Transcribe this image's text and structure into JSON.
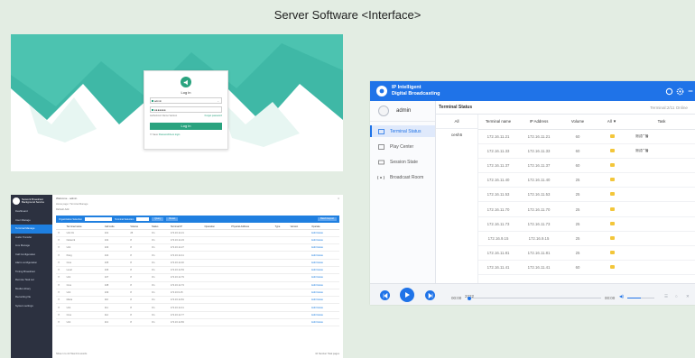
{
  "page": {
    "title": "Server Software <Interface>"
  },
  "login": {
    "title": "Log in",
    "username": "admin",
    "password_mask": "●●●●●●●",
    "meta_left": "Authorized: Demo Version",
    "meta_right": "Forget password",
    "button": "Log in",
    "remember_prefix": "Save",
    "remember_link": "Password/Auto login",
    "colors": {
      "accent": "#2aa37f",
      "background": "#3fb8a6"
    }
  },
  "admin": {
    "brand": "Network Broadcast Background Service",
    "top_left": "Welcome - admin",
    "breadcrumb": "Home page / Terminal Manage",
    "tools": "Refresh  Add",
    "filter": {
      "left_label": "Organization Selection",
      "mid_label": "Terminal Selection",
      "search": "Query",
      "reset": "Reset",
      "export": "Batch Export"
    },
    "menu": [
      "Dashboard",
      "User Manage",
      "Terminal Manage",
      "Audio Transfer",
      "Live Manage",
      "Call Configuration",
      "Alarm configuration",
      "Timing Broadcast",
      "Remote Task set",
      "Media Library",
      "Recording file",
      "System settings"
    ],
    "columns": [
      "",
      "Terminal name",
      "Call code",
      "Volume",
      "Status",
      "Terminal IP",
      "Operation",
      "Physical Address",
      "Type",
      "Version",
      "Operate"
    ],
    "rows": [
      [
        "",
        "Unit 01",
        "101",
        "25",
        "On",
        "172.16.11.21",
        "",
        "",
        "",
        "",
        "Edit Delete"
      ],
      [
        "",
        "Network",
        "102",
        "8",
        "On",
        "172.16.11.23",
        "",
        "",
        "",
        "",
        "Edit Delete"
      ],
      [
        "",
        "Unit",
        "103",
        "8",
        "On",
        "172.16.11.27",
        "",
        "",
        "",
        "",
        "Edit Delete"
      ],
      [
        "",
        "Pang",
        "104",
        "8",
        "On",
        "172.16.11.41",
        "",
        "",
        "",
        "",
        "Edit Delete"
      ],
      [
        "",
        "Cres",
        "105",
        "8",
        "On",
        "172.16.11.40",
        "",
        "",
        "",
        "",
        "Edit Delete"
      ],
      [
        "",
        "Level",
        "106",
        "8",
        "On",
        "172.16.11.53",
        "",
        "",
        "",
        "",
        "Edit Delete"
      ],
      [
        "",
        "Unit",
        "107",
        "8",
        "On",
        "172.16.11.79",
        "",
        "",
        "",
        "",
        "Edit Delete"
      ],
      [
        "",
        "Cres",
        "108",
        "8",
        "On",
        "172.16.11.73",
        "",
        "",
        "",
        "",
        "Edit Delete"
      ],
      [
        "",
        "Unit",
        "109",
        "8",
        "On",
        "172.16.9.15",
        "",
        "",
        "",
        "",
        "Edit Delete"
      ],
      [
        "",
        "Maria",
        "110",
        "8",
        "On",
        "172.16.11.81",
        "",
        "",
        "",
        "",
        "Edit Delete"
      ],
      [
        "",
        "Unit",
        "111",
        "8",
        "On",
        "172.16.11.41",
        "",
        "",
        "",
        "",
        "Edit Delete"
      ],
      [
        "",
        "Cres",
        "112",
        "8",
        "On",
        "172.16.11.77",
        "",
        "",
        "",
        "",
        "Edit Delete"
      ],
      [
        "",
        "Unit",
        "113",
        "8",
        "On",
        "172.16.11.83",
        "",
        "",
        "",
        "",
        "Edit Delete"
      ]
    ],
    "footer_left": "Show 1 to 13 Total 13 records",
    "footer_right": "10  Number  Total pages"
  },
  "terminal": {
    "brand_line1": "IP Intelligent",
    "brand_line2": "Digital Broadcasting",
    "user": "admin",
    "nav": [
      "Terminal Status",
      "Play Center",
      "Session State",
      "Broadcast Room"
    ],
    "topbar_title": "Terminal Status",
    "online_text": "Terminal:2/11 Online",
    "groups_header": "All",
    "groups": [
      "cesh5"
    ],
    "columns": [
      "Terminal name",
      "IP Address",
      "Volume",
      "All",
      "Task"
    ],
    "rows": [
      {
        "name": "172.16.11.21",
        "ip": "172.16.11.21",
        "volume": "60",
        "task": "测试广播"
      },
      {
        "name": "172.16.11.33",
        "ip": "172.16.11.33",
        "volume": "60",
        "task": "测试广播"
      },
      {
        "name": "172.16.11.37",
        "ip": "172.16.11.37",
        "volume": "60",
        "task": ""
      },
      {
        "name": "172.16.11.40",
        "ip": "172.16.11.40",
        "volume": "25",
        "task": ""
      },
      {
        "name": "172.16.11.53",
        "ip": "172.16.11.53",
        "volume": "25",
        "task": ""
      },
      {
        "name": "172.16.11.70",
        "ip": "172.16.11.70",
        "volume": "25",
        "task": ""
      },
      {
        "name": "172.16.11.73",
        "ip": "172.16.11.73",
        "volume": "25",
        "task": ""
      },
      {
        "name": "172.16.9.15",
        "ip": "172.16.9.15",
        "volume": "25",
        "task": ""
      },
      {
        "name": "172.16.11.81",
        "ip": "172.16.11.81",
        "volume": "25",
        "task": ""
      },
      {
        "name": "172.16.11.41",
        "ip": "172.16.11.41",
        "volume": "60",
        "task": ""
      }
    ],
    "player": {
      "track": "2222",
      "elapsed": "00:00",
      "duration": "00:00",
      "volume_level": 0.5
    },
    "colors": {
      "accent": "#1f73e8",
      "speaker": "#f3c63a"
    }
  }
}
